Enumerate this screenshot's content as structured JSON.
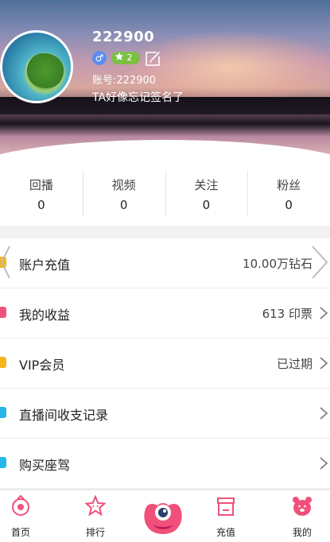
{
  "profile": {
    "username": "222900",
    "gender_symbol": "♂",
    "level": "2",
    "account": "账号:222900",
    "signature": "TA好像忘记签名了"
  },
  "stats": [
    {
      "label": "回播",
      "value": "0"
    },
    {
      "label": "视频",
      "value": "0"
    },
    {
      "label": "关注",
      "value": "0"
    },
    {
      "label": "粉丝",
      "value": "0"
    }
  ],
  "menu": [
    {
      "label": "账户充值",
      "value": "10.00万钻石",
      "icon_color": "#f5b51d"
    },
    {
      "label": "我的收益",
      "value": "613 印票",
      "icon_color": "#f0507a"
    },
    {
      "label": "VIP会员",
      "value": "已过期",
      "icon_color": "#f5b51d"
    },
    {
      "label": "直播间收支记录",
      "value": "",
      "icon_color": "#27b6e8"
    },
    {
      "label": "购买座驾",
      "value": "",
      "icon_color": "#27b6e8"
    }
  ],
  "tabbar": {
    "home": "首页",
    "rank": "排行",
    "recharge": "充值",
    "mine": "我的",
    "accent": "#f0507a"
  }
}
